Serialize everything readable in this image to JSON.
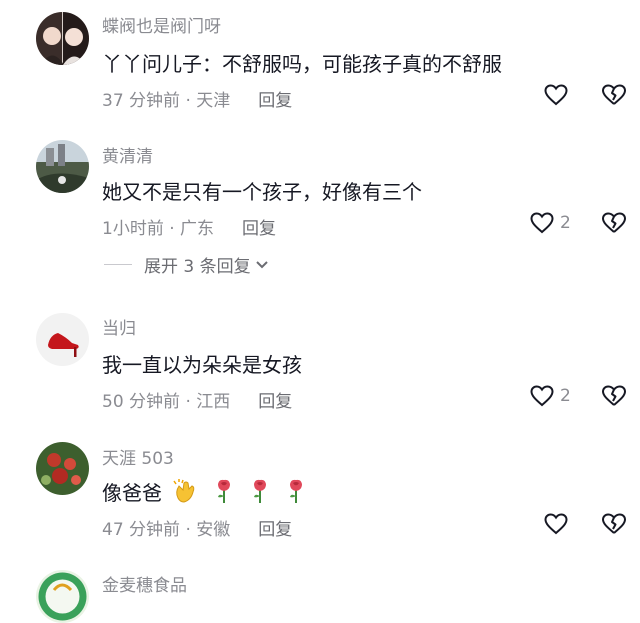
{
  "comments": [
    {
      "username": "蝶阀也是阀门呀",
      "text": "丫丫问儿子：不舒服吗，可能孩子真的不舒服",
      "meta": "37 分钟前 · 天津",
      "reply_label": "回复",
      "like_count": "",
      "avatar_icon": "two-women-photo"
    },
    {
      "username": "黄清清",
      "text": "她又不是只有一个孩子，好像有三个",
      "meta": "1小时前 · 广东",
      "reply_label": "回复",
      "like_count": "2",
      "avatar_icon": "landscape-photo"
    },
    {
      "username": "当归",
      "text": "我一直以为朵朵是女孩",
      "meta": "50 分钟前 · 江西",
      "reply_label": "回复",
      "like_count": "2",
      "avatar_icon": "red-high-heel-shoe"
    },
    {
      "username": "天涯 503",
      "text": "像爸爸",
      "meta": "47 分钟前 · 安徽",
      "reply_label": "回复",
      "like_count": "",
      "avatar_icon": "flowers-photo",
      "emojis": [
        "clapping-hands-icon",
        "rose-icon",
        "rose-icon",
        "rose-icon"
      ]
    },
    {
      "username": "金麦穗食品",
      "avatar_icon": "green-logo"
    }
  ],
  "expand_replies_label": "展开 3 条回复",
  "colors": {
    "text": "#161823",
    "secondary": "#8a8b91",
    "reply": "#6b6c72",
    "background": "#ffffff"
  }
}
